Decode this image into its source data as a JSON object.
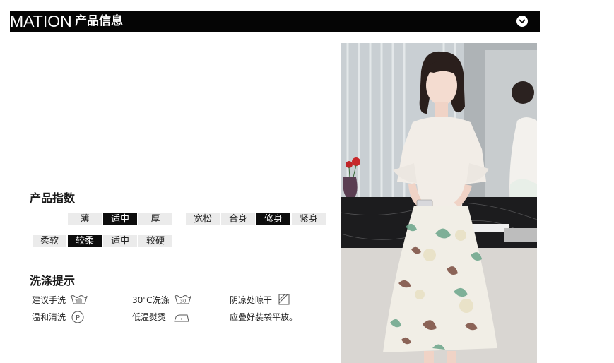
{
  "header": {
    "title_en": "MATION",
    "title_cn": "产品信息",
    "toggle_icon": "chevron-down-circle-icon"
  },
  "product_index": {
    "title": "产品指数",
    "thickness": [
      {
        "label": "薄",
        "active": false
      },
      {
        "label": "适中",
        "active": true
      },
      {
        "label": "厚",
        "active": false
      }
    ],
    "fit": [
      {
        "label": "宽松",
        "active": false
      },
      {
        "label": "合身",
        "active": false
      },
      {
        "label": "修身",
        "active": true
      },
      {
        "label": "紧身",
        "active": false
      }
    ],
    "softness": [
      {
        "label": "柔软",
        "active": false
      },
      {
        "label": "较柔",
        "active": true
      },
      {
        "label": "适中",
        "active": false
      },
      {
        "label": "较硬",
        "active": false
      }
    ]
  },
  "washing": {
    "title": "洗涤提示",
    "items": [
      {
        "label": "建议手洗",
        "icon": "hand-wash-icon"
      },
      {
        "label": "30℃洗涤",
        "icon": "wash-30-icon",
        "icon_text": "30"
      },
      {
        "label": "阴凉处晾干",
        "icon": "dry-shade-icon"
      },
      {
        "label": "温和清洗",
        "icon": "gentle-clean-p-icon",
        "icon_text": "P"
      },
      {
        "label": "低温熨烫",
        "icon": "low-iron-icon"
      },
      {
        "label": "应叠好装袋平放。",
        "icon": ""
      }
    ]
  },
  "colors": {
    "header_bg": "#050505",
    "active_seg": "#0d0d0d",
    "inactive_seg": "#ebebeb"
  }
}
